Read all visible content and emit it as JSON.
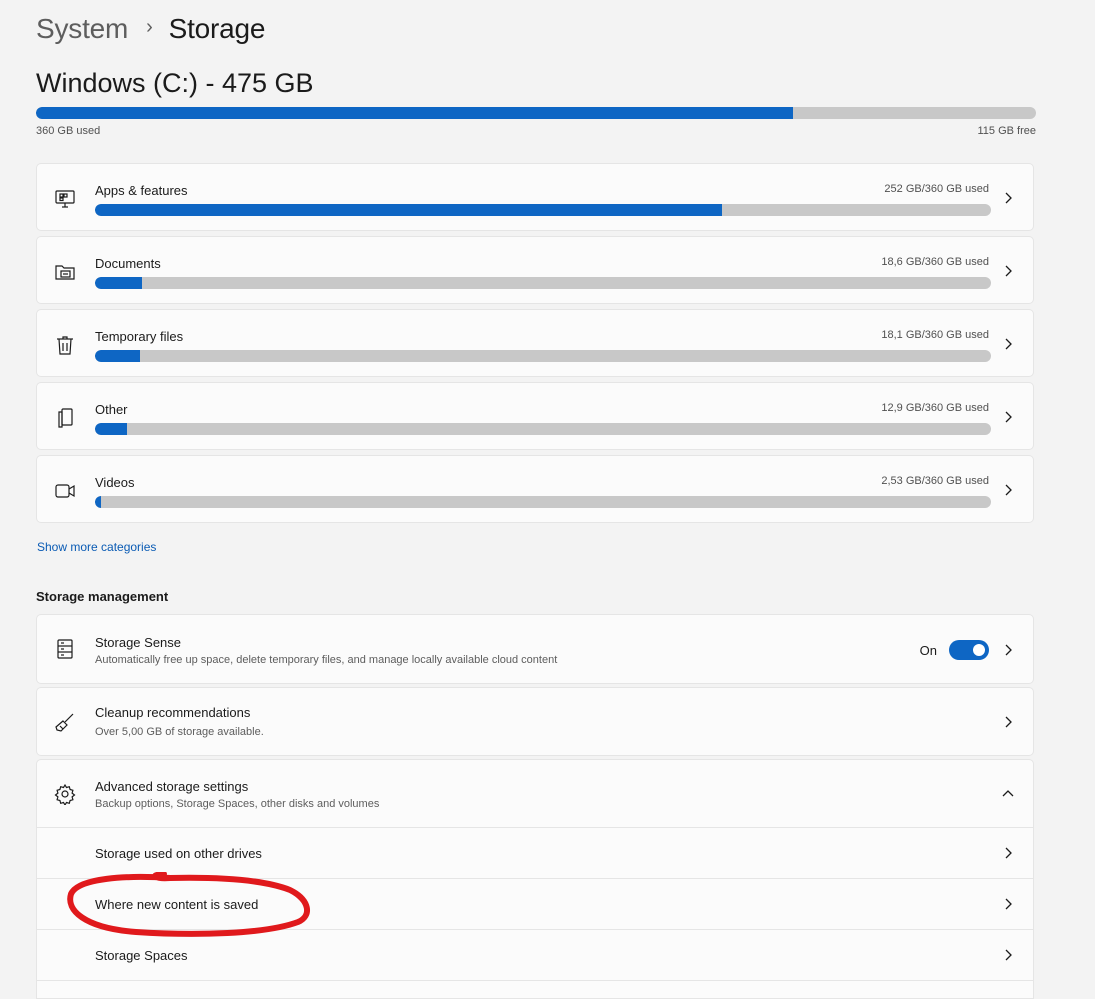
{
  "breadcrumb": {
    "parent": "System",
    "separator": "›",
    "current": "Storage"
  },
  "drive": {
    "title": "Windows (C:) - 475 GB",
    "used_label": "360 GB used",
    "free_label": "115 GB free",
    "used_fraction": 0.757
  },
  "categories": [
    {
      "label": "Apps & features",
      "amount": "252 GB/360 GB used",
      "fraction": 0.7,
      "icon": "apps-icon"
    },
    {
      "label": "Documents",
      "amount": "18,6 GB/360 GB used",
      "fraction": 0.052,
      "icon": "folder-icon"
    },
    {
      "label": "Temporary files",
      "amount": "18,1 GB/360 GB used",
      "fraction": 0.05,
      "icon": "trash-icon"
    },
    {
      "label": "Other",
      "amount": "12,9 GB/360 GB used",
      "fraction": 0.036,
      "icon": "file-icon"
    },
    {
      "label": "Videos",
      "amount": "2,53 GB/360 GB used",
      "fraction": 0.007,
      "icon": "video-icon"
    }
  ],
  "show_more": "Show more categories",
  "management": {
    "heading": "Storage management",
    "storage_sense": {
      "title": "Storage Sense",
      "subtitle": "Automatically free up space, delete temporary files, and manage locally available cloud content",
      "toggle_label": "On",
      "toggle_on": true
    },
    "cleanup": {
      "title": "Cleanup recommendations",
      "subtitle": "Over 5,00 GB of storage available."
    },
    "advanced": {
      "title": "Advanced storage settings",
      "subtitle": "Backup options, Storage Spaces, other disks and volumes",
      "items": [
        {
          "label": "Storage used on other drives"
        },
        {
          "label": "Where new content is saved"
        },
        {
          "label": "Storage Spaces"
        }
      ]
    }
  },
  "colors": {
    "accent": "#0e66c4",
    "annotation": "#e0191c"
  }
}
